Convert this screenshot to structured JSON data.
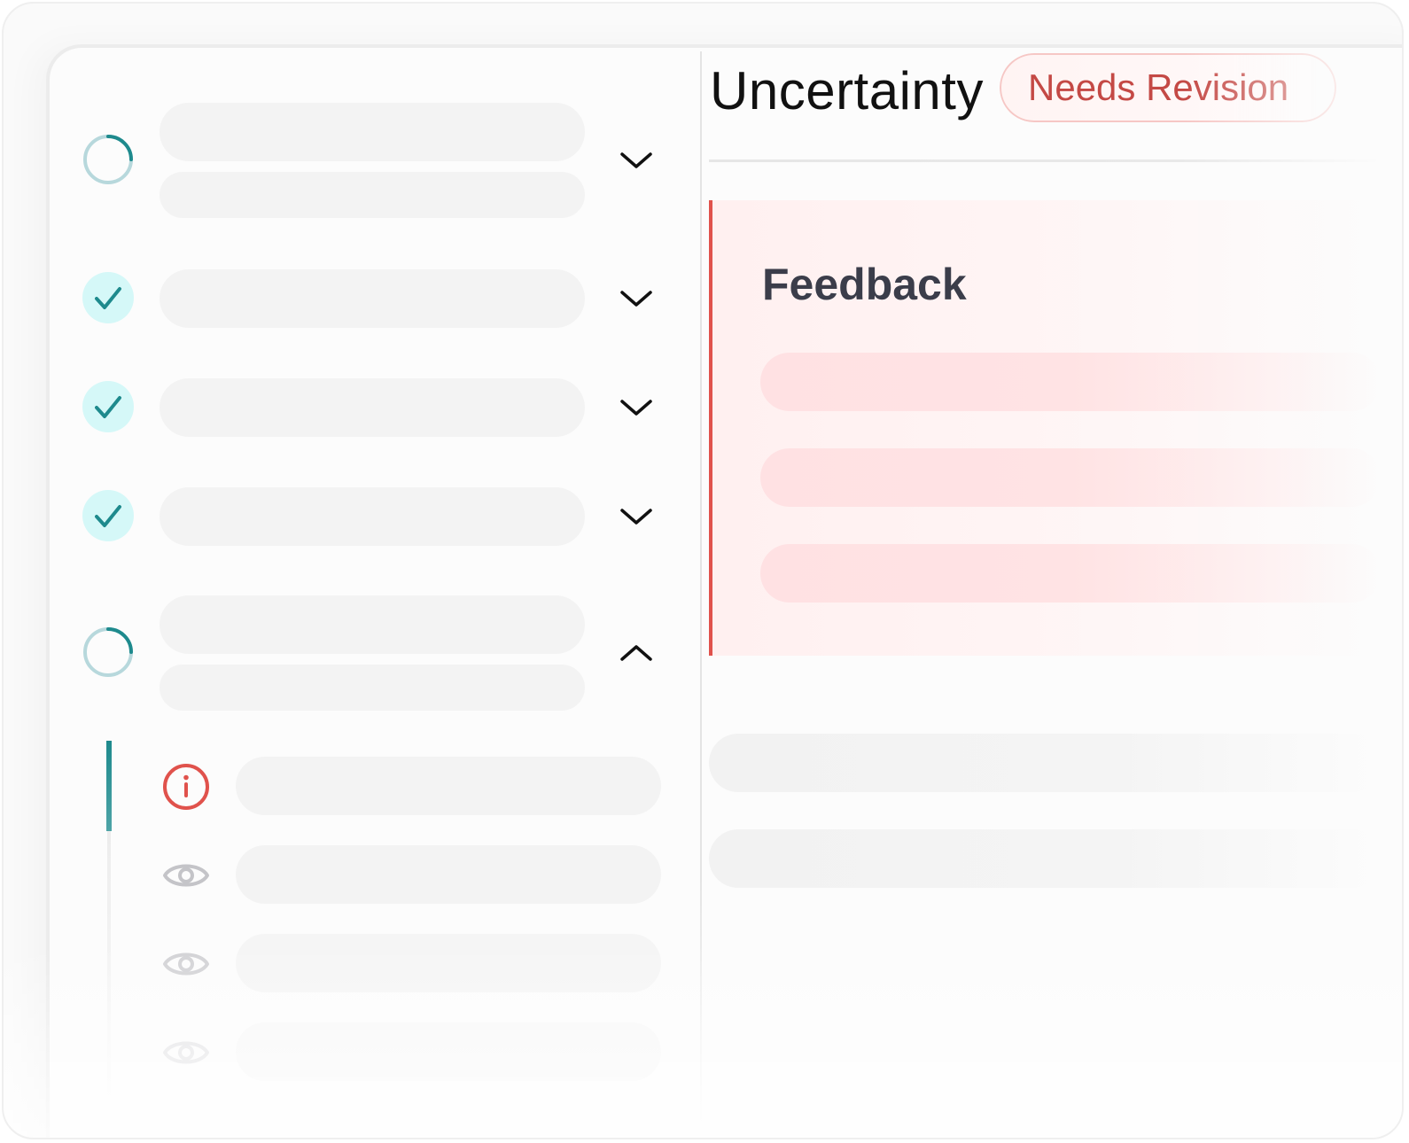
{
  "detail": {
    "title": "Uncertainty",
    "status_badge": "Needs Revision",
    "feedback_heading": "Feedback"
  },
  "steps": [
    {
      "status": "in-progress",
      "icon": "progress-ring-icon",
      "expanded": false
    },
    {
      "status": "complete",
      "icon": "check-icon",
      "expanded": false
    },
    {
      "status": "complete",
      "icon": "check-icon",
      "expanded": false
    },
    {
      "status": "complete",
      "icon": "check-icon",
      "expanded": false
    },
    {
      "status": "in-progress",
      "icon": "progress-ring-icon",
      "expanded": true
    }
  ],
  "sub_items": [
    {
      "icon": "info-icon",
      "state": "flagged"
    },
    {
      "icon": "eye-icon",
      "state": "viewed"
    },
    {
      "icon": "eye-icon",
      "state": "viewed"
    },
    {
      "icon": "eye-icon",
      "state": "viewed"
    }
  ],
  "colors": {
    "accent": "#1e8a8d",
    "check_bg": "#d5f8f8",
    "alert": "#e0524c",
    "badge_text": "#c44945",
    "feedback_bg": "#fff0f0"
  }
}
